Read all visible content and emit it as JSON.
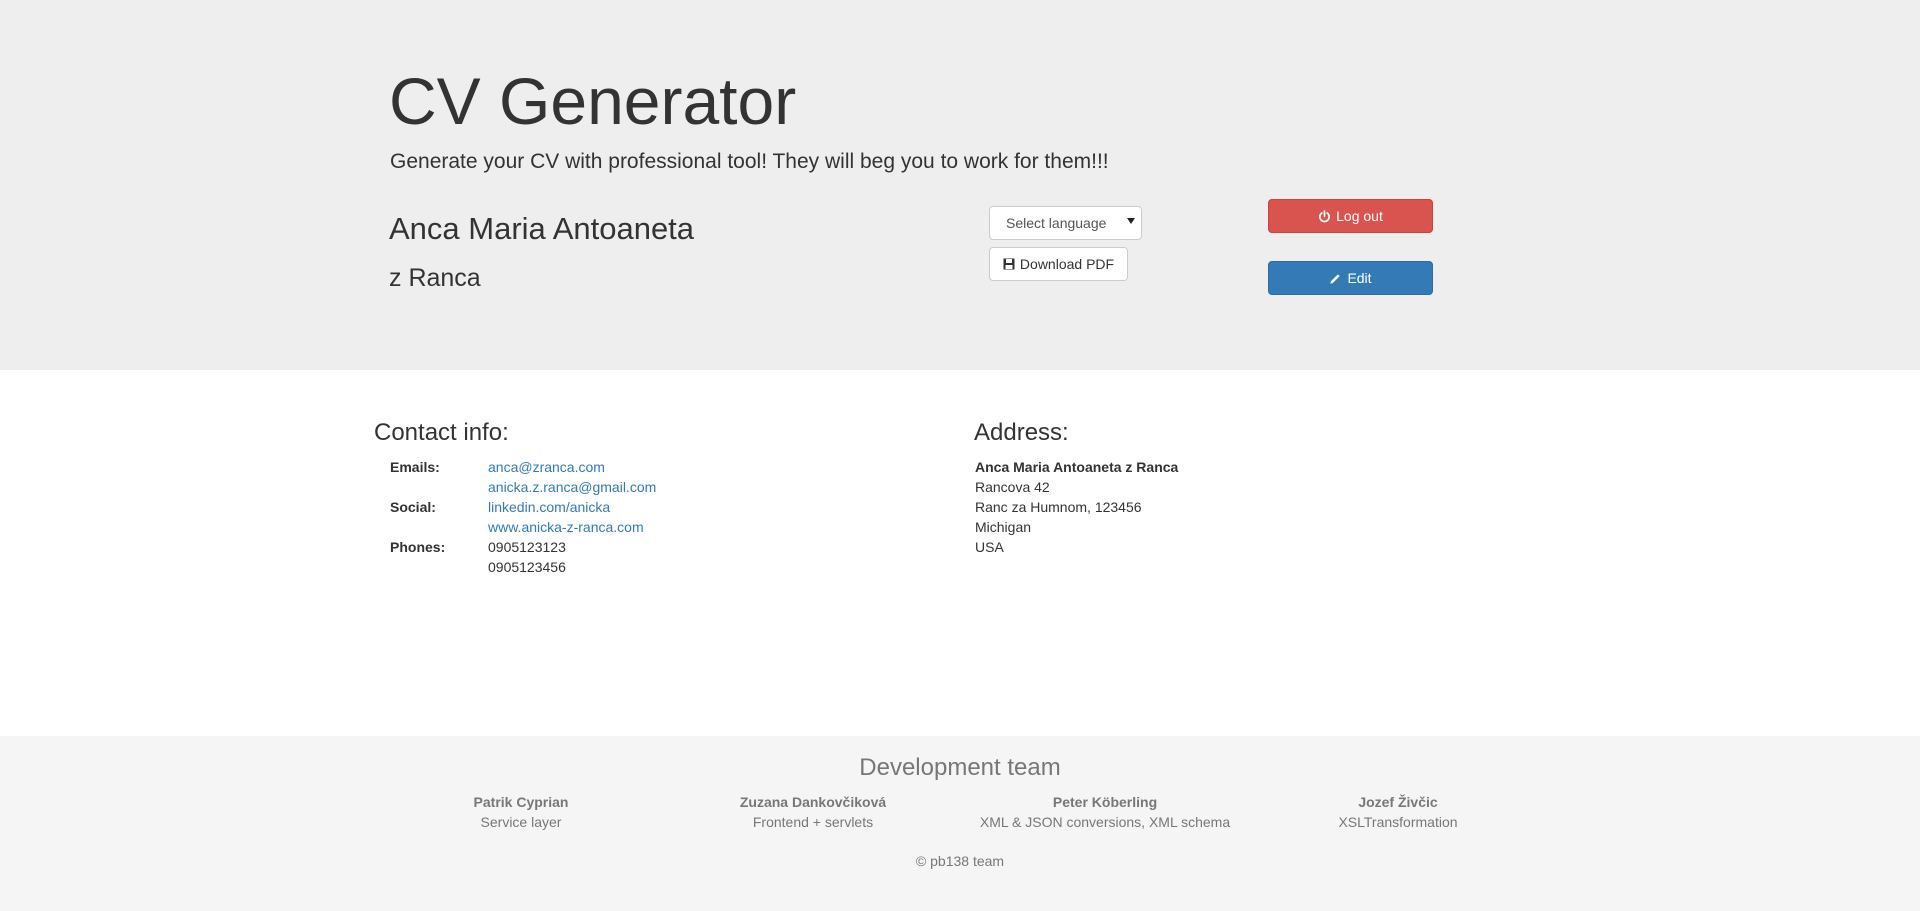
{
  "header": {
    "title": "CV Generator",
    "subtitle": "Generate your CV with professional tool! They will beg you to work for them!!!",
    "name": "Anca Maria Antoaneta",
    "surname": "z Ranca"
  },
  "controls": {
    "select_language": "Select language",
    "download_pdf": "Download PDF",
    "logout": "Log out",
    "edit": "Edit",
    "colors": {
      "logout_bg": "#d9534f",
      "edit_bg": "#337ab7",
      "link": "#337ab7"
    }
  },
  "contact": {
    "heading": "Contact info:",
    "emails_label": "Emails:",
    "emails": [
      "anca@zranca.com",
      "anicka.z.ranca@gmail.com"
    ],
    "social_label": "Social:",
    "social": [
      "linkedin.com/anicka",
      "www.anicka-z-ranca.com"
    ],
    "phones_label": "Phones:",
    "phones": [
      "0905123123",
      "0905123456"
    ]
  },
  "address": {
    "heading": "Address:",
    "lines": [
      "Anca Maria Antoaneta z Ranca",
      "Rancova 42",
      "Ranc za Humnom, 123456",
      "Michigan",
      "USA"
    ]
  },
  "footer": {
    "title": "Development team",
    "members": [
      {
        "name": "Patrik Cyprian",
        "role": "Service layer"
      },
      {
        "name": "Zuzana Dankovčiková",
        "role": "Frontend + servlets"
      },
      {
        "name": "Peter Köberling",
        "role": "XML & JSON conversions, XML schema"
      },
      {
        "name": "Jozef Živčic",
        "role": "XSLTransformation"
      }
    ],
    "copyright": "© pb138 team"
  }
}
